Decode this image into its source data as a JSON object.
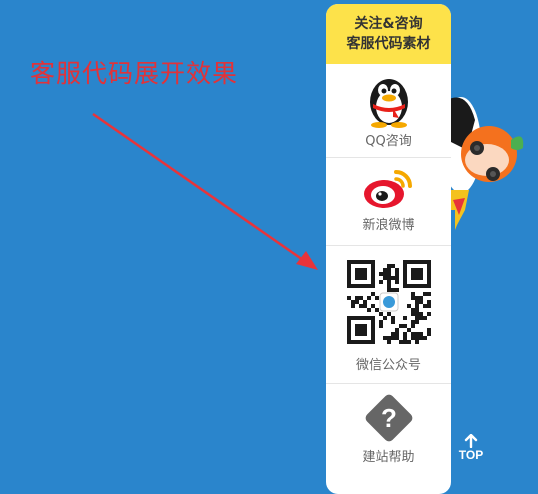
{
  "caption": "客服代码展开效果",
  "panel": {
    "header_line1": "关注&咨询",
    "header_line2": "客服代码素材",
    "items": [
      {
        "label": "QQ咨询",
        "icon": "qq-penguin-icon"
      },
      {
        "label": "新浪微博",
        "icon": "weibo-icon"
      },
      {
        "label": "微信公众号",
        "icon": "wechat-qr-code"
      },
      {
        "label": "建站帮助",
        "icon": "help-question-icon"
      }
    ]
  },
  "top_button": {
    "label": "TOP",
    "icon": "arrow-up-icon"
  },
  "colors": {
    "background": "#2a85cc",
    "caption": "#e0333a",
    "header": "#fde24a",
    "arrow": "#e8343a"
  }
}
